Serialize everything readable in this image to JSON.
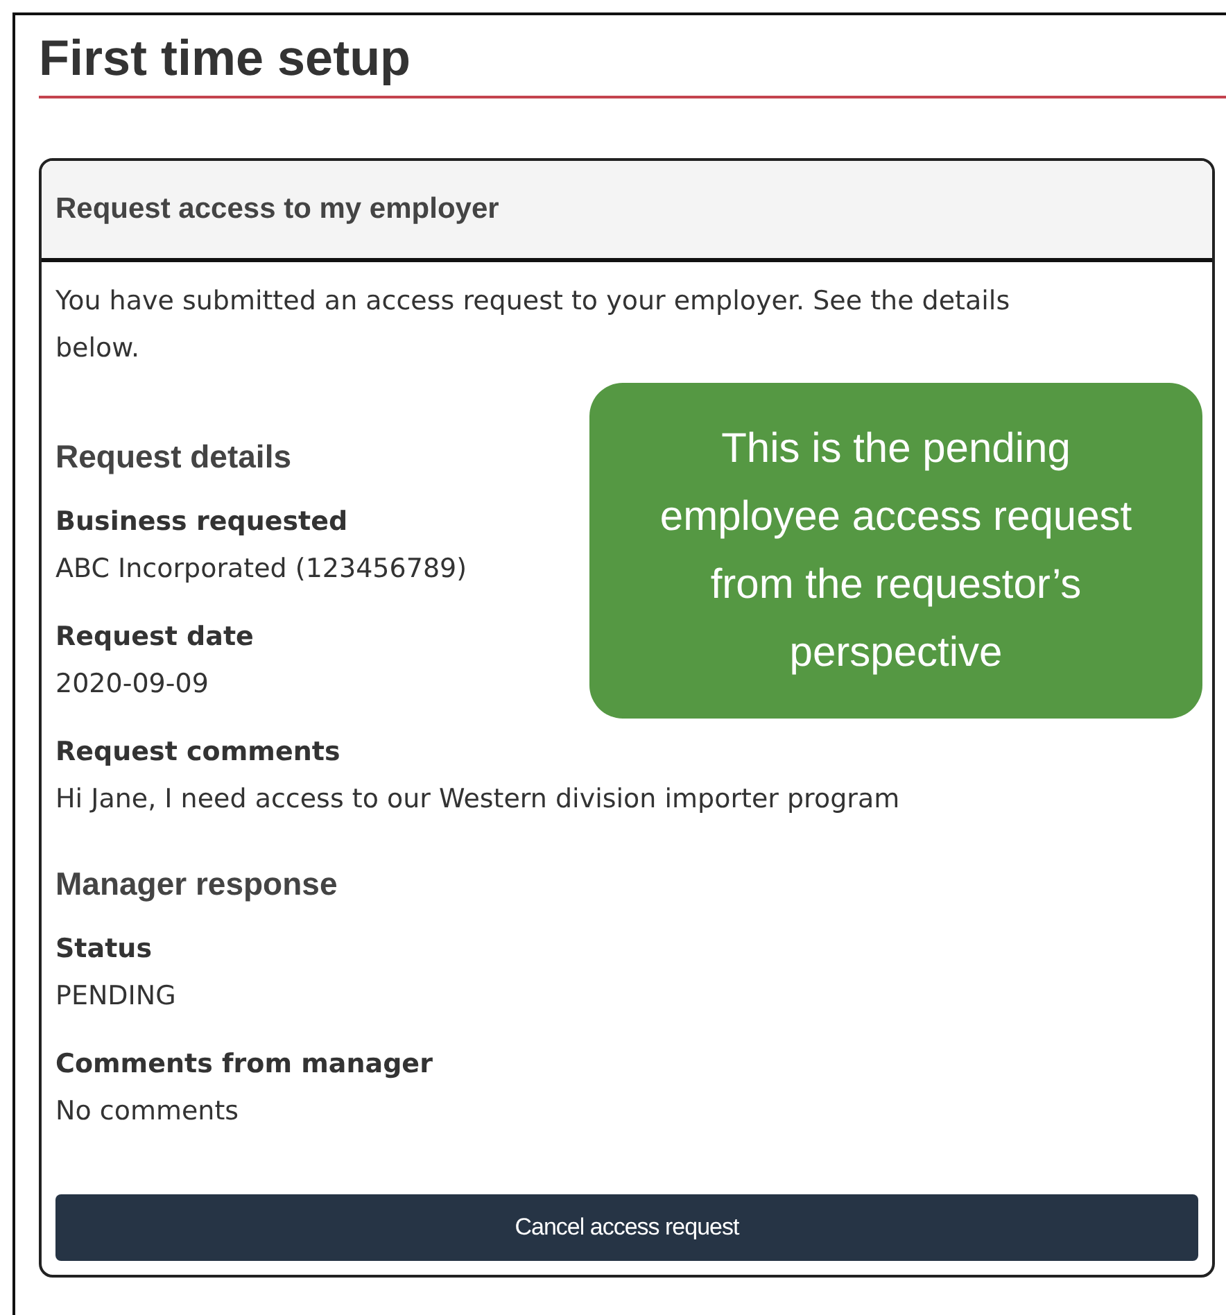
{
  "page_title": "First time setup",
  "card": {
    "title": "Request access to my employer",
    "intro": "You have submitted an access request to your employer. See the details below.",
    "sections": [
      {
        "heading": "Request details",
        "fields": [
          {
            "label": "Business requested",
            "value": "ABC Incorporated (123456789)"
          },
          {
            "label": "Request date",
            "value": "2020-09-09"
          },
          {
            "label": "Request comments",
            "value": "Hi Jane, I need access to our Western division importer program"
          }
        ]
      },
      {
        "heading": "Manager response",
        "fields": [
          {
            "label": "Status",
            "value": "PENDING"
          },
          {
            "label": "Comments from manager",
            "value": "No comments"
          }
        ]
      }
    ],
    "button": "Cancel access request"
  },
  "callout": {
    "text": "This is the pending employee access request from the requestor’s perspective"
  }
}
